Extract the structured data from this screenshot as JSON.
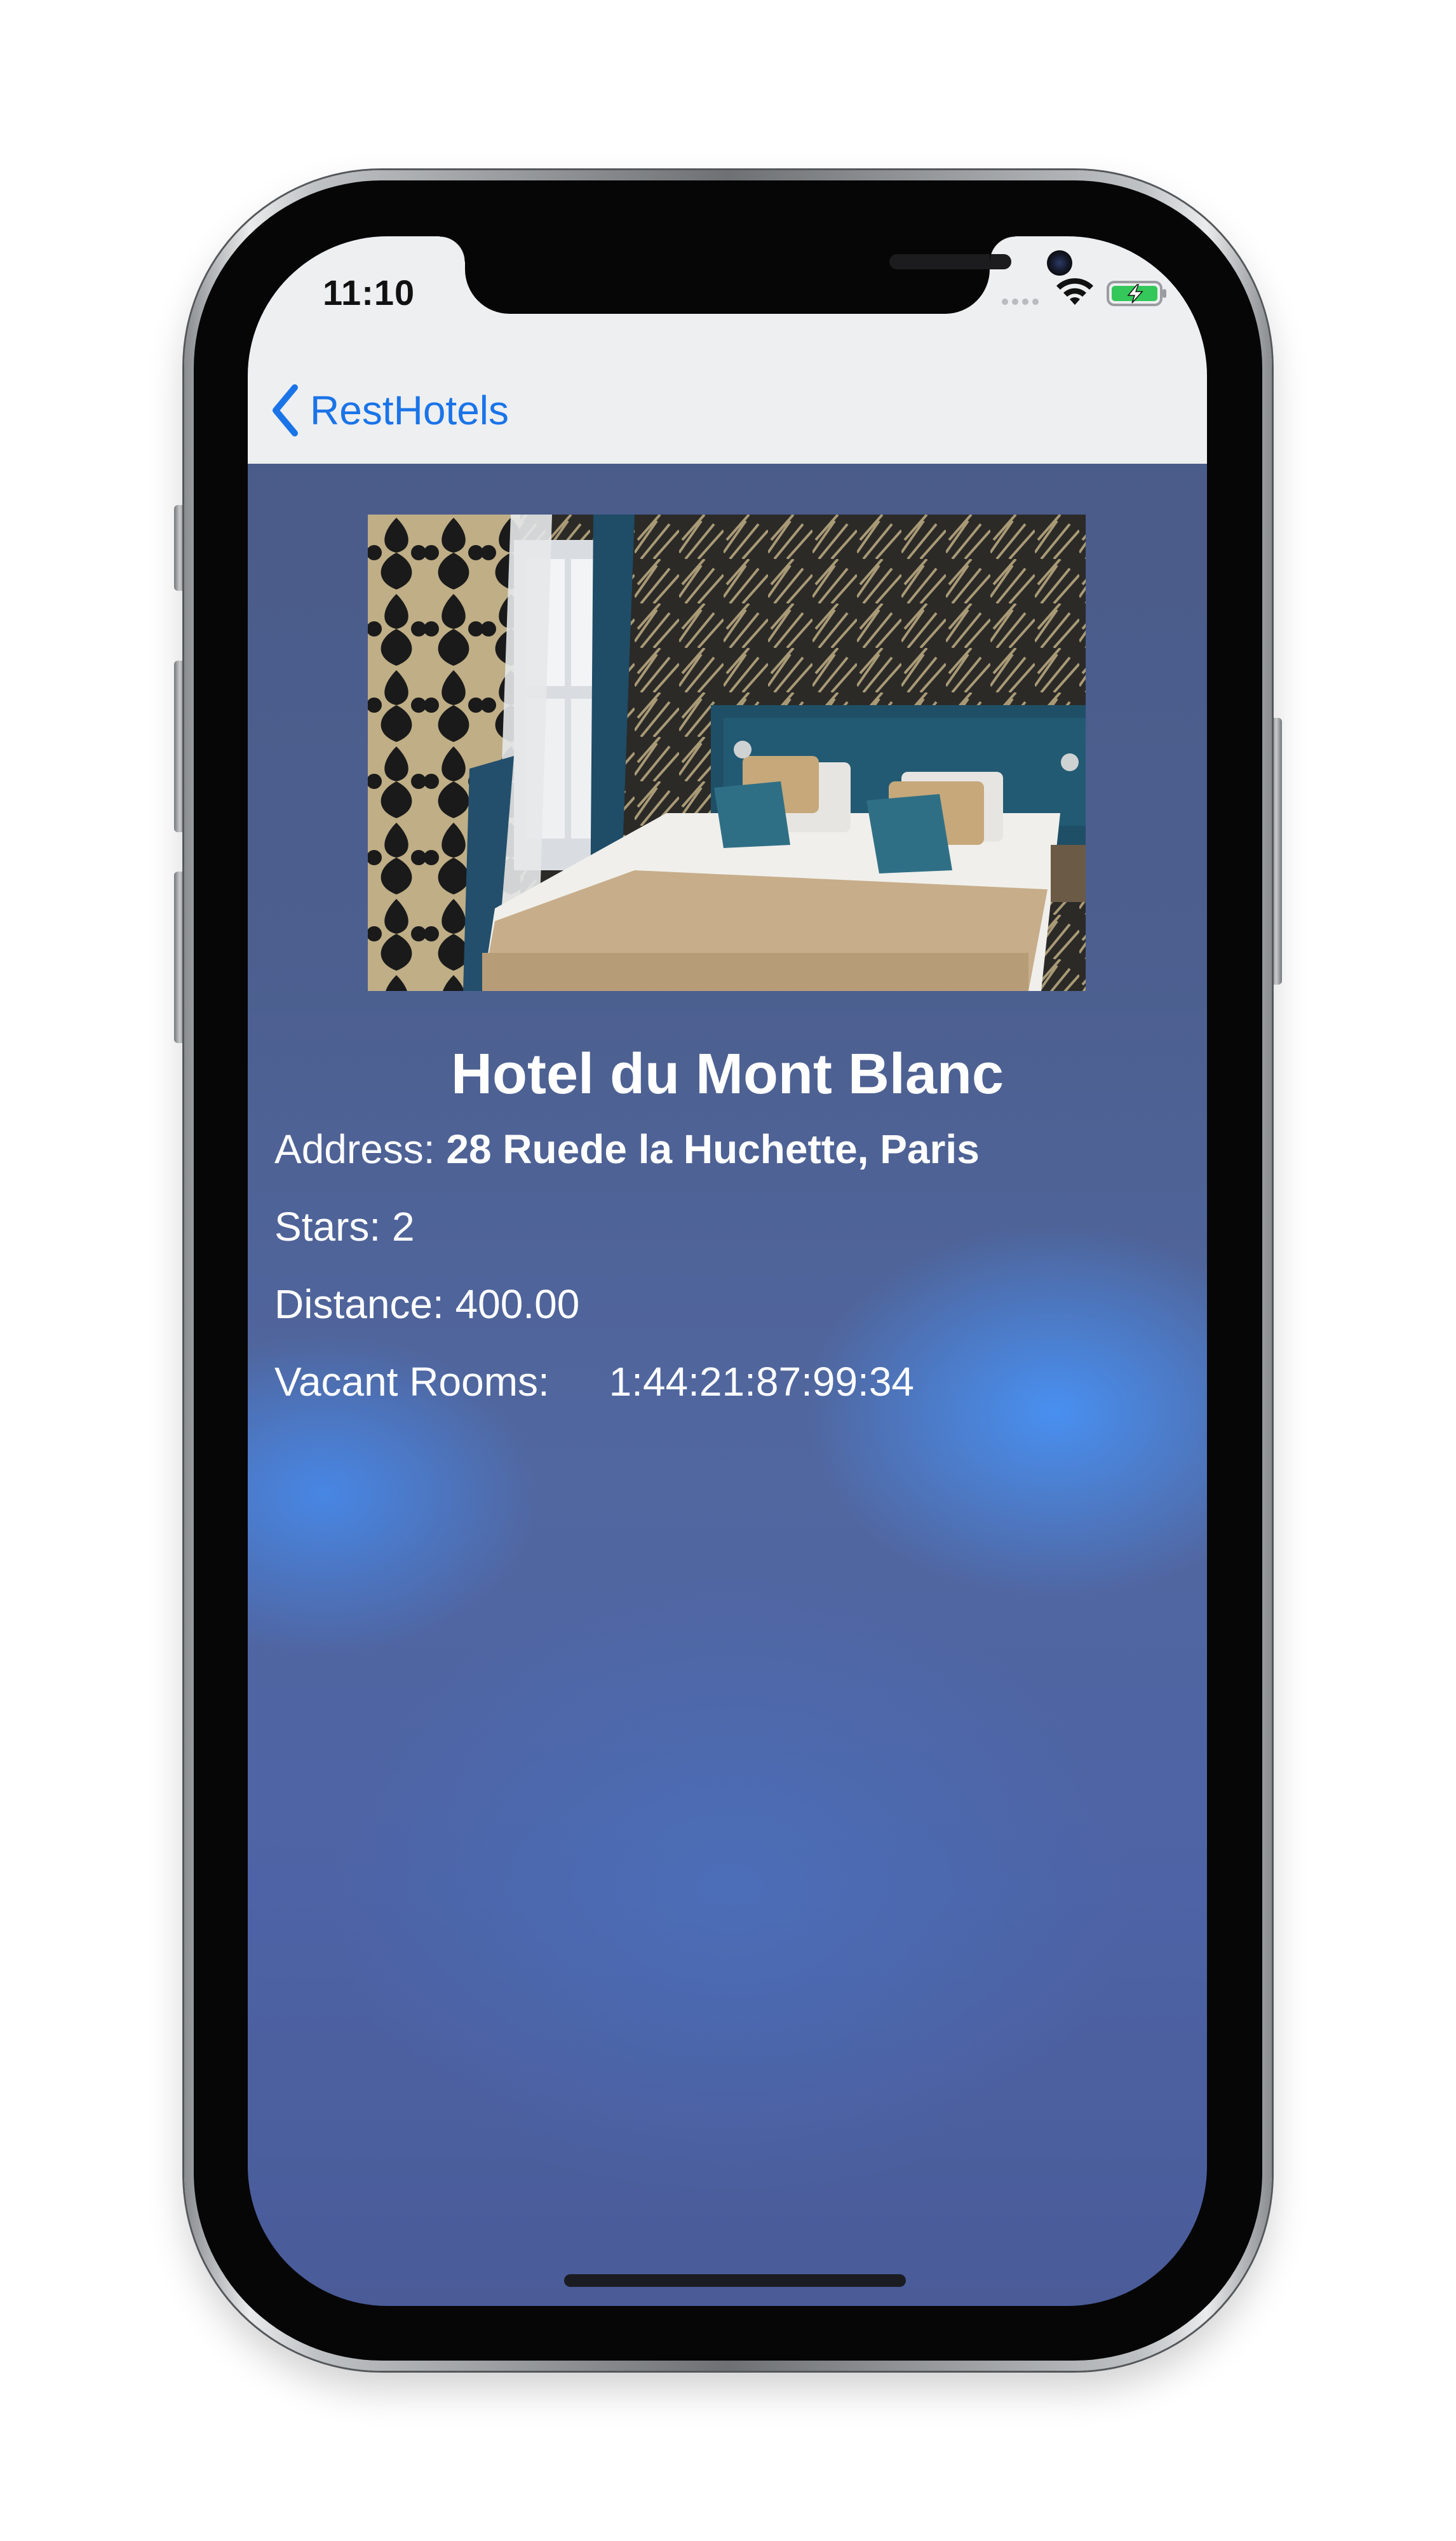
{
  "status_bar": {
    "time": "11:10"
  },
  "nav": {
    "back_label": "RestHotels"
  },
  "hotel": {
    "name": "Hotel du Mont Blanc",
    "address_label": "Address:",
    "address_value": "28 Ruede la Huchette, Paris",
    "stars_label": "Stars:",
    "stars_value": "2",
    "distance_label": "Distance:",
    "distance_value": "400.00",
    "vacant_label": "Vacant Rooms:",
    "vacant_value": "1:44:21:87:99:34"
  },
  "icons": {
    "back": "chevron-left-icon",
    "wifi": "wifi-icon",
    "battery": "battery-charging-icon",
    "photo": "hotel-room-photo"
  },
  "colors": {
    "accent": "#1a74e8",
    "nav_background": "#eeeff1",
    "content_background": "#4c5f8f",
    "text": "#ffffff",
    "battery_fill": "#34c759"
  }
}
